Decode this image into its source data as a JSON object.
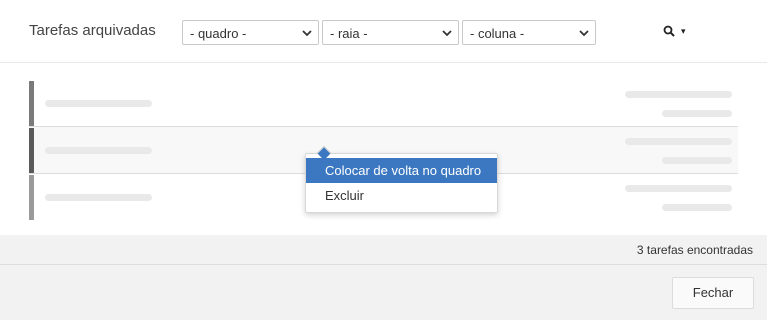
{
  "header": {
    "title": "Tarefas arquivadas",
    "filters": {
      "board": "- quadro -",
      "swimlane": "- raia -",
      "column": "- coluna -"
    },
    "search_icon": "search-icon",
    "search_caret": "▾"
  },
  "tasks": [
    {
      "color": "#7a7a7a"
    },
    {
      "color": "#5a5a5a"
    },
    {
      "color": "#9a9a9a"
    }
  ],
  "context_menu": {
    "items": [
      {
        "label": "Colocar de volta no quadro",
        "active": true
      },
      {
        "label": "Excluir",
        "active": false
      }
    ],
    "highlight_color": "#3c78c1"
  },
  "summary": {
    "text": "3 tarefas encontradas"
  },
  "footer": {
    "close_label": "Fechar"
  }
}
